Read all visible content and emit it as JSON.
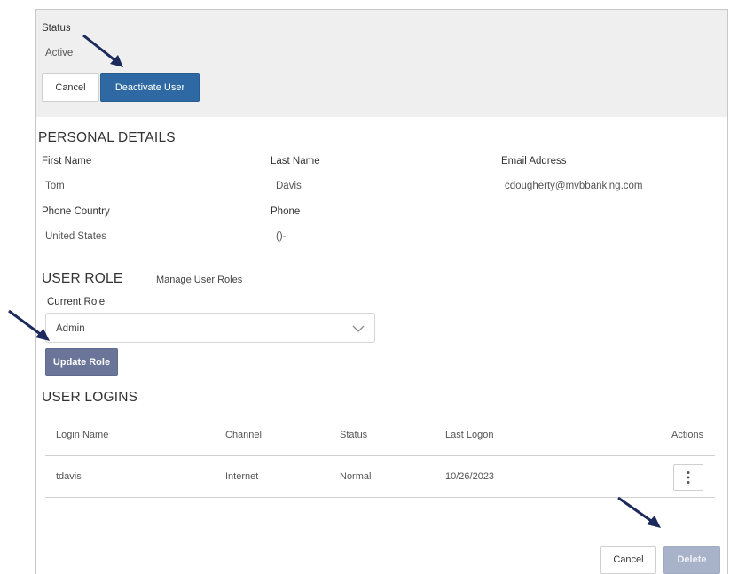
{
  "status_section": {
    "label": "Status",
    "value": "Active",
    "cancel_label": "Cancel",
    "deactivate_label": "Deactivate User"
  },
  "personal_details": {
    "heading": "PERSONAL DETAILS",
    "first_name_label": "First Name",
    "first_name": "Tom",
    "last_name_label": "Last Name",
    "last_name": "Davis",
    "email_label": "Email Address",
    "email": "cdougherty@mvbbanking.com",
    "phone_country_label": "Phone Country",
    "phone_country": "United States",
    "phone_label": "Phone",
    "phone": "()-"
  },
  "user_role": {
    "heading": "USER ROLE",
    "manage_link": "Manage User Roles",
    "current_role_label": "Current Role",
    "current_role": "Admin",
    "update_label": "Update Role"
  },
  "user_logins": {
    "heading": "USER LOGINS",
    "columns": [
      "Login Name",
      "Channel",
      "Status",
      "Last Logon",
      "Actions"
    ],
    "rows": [
      {
        "login_name": "tdavis",
        "channel": "Internet",
        "status": "Normal",
        "last_logon": "10/26/2023"
      }
    ],
    "cancel_label": "Cancel",
    "delete_label": "Delete"
  },
  "colors": {
    "primary": "#2e69a3",
    "update_button": "#6a7599",
    "disabled_button": "#a8b2c8",
    "annotation_arrow": "#1c2a5c",
    "panel_background": "#efefef"
  },
  "icons": {
    "dropdown": "chevron-down-icon",
    "row_actions": "kebab-menu-icon",
    "annotation": "arrow-icon"
  }
}
